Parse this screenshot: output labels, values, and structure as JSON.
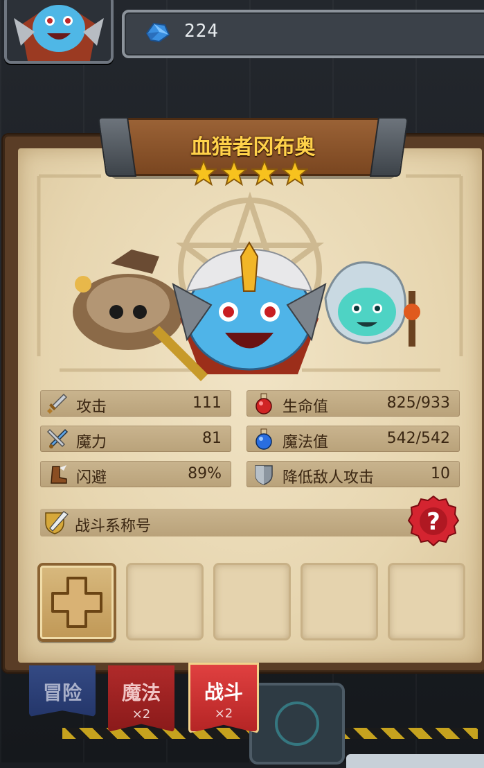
{
  "currency": {
    "icon": "blue-gem-icon",
    "amount": "224"
  },
  "hero": {
    "name": "血猎者冈布奥",
    "stars": 4
  },
  "stats": {
    "attack": {
      "label": "攻击",
      "value": "111",
      "icon": "sword-icon"
    },
    "magic_power": {
      "label": "魔力",
      "value": "81",
      "icon": "crossed-blade-icon"
    },
    "dodge": {
      "label": "闪避",
      "value": "89%",
      "icon": "winged-boot-icon"
    },
    "hp": {
      "label": "生命值",
      "value": "825/933",
      "icon": "red-potion-icon"
    },
    "mp": {
      "label": "魔法值",
      "value": "542/542",
      "icon": "blue-potion-icon"
    },
    "reduce_attack": {
      "label": "降低敌人攻击",
      "value": "10",
      "icon": "shield-icon"
    }
  },
  "battle_title": {
    "label": "战斗系称号",
    "help_icon": "question-mark-icon"
  },
  "slots": [
    "add",
    "empty",
    "empty",
    "empty",
    "empty"
  ],
  "tabs": [
    {
      "name": "冒险",
      "multiplier": ""
    },
    {
      "name": "魔法",
      "multiplier": "×2"
    },
    {
      "name": "战斗",
      "multiplier": "×2"
    }
  ],
  "colors": {
    "title_text": "#ffd24a",
    "parchment": "#e7d6b0",
    "stat_bar": "#c0aa83",
    "help_badge": "#d42430",
    "battle_tab": "#d03434"
  }
}
